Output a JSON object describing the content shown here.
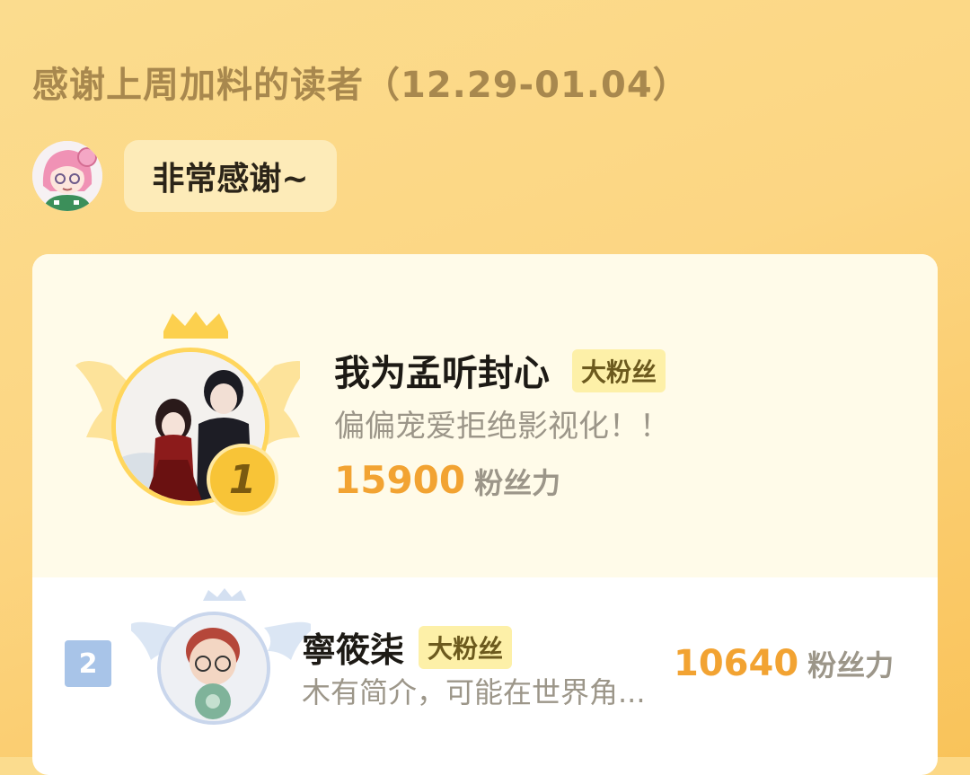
{
  "header": {
    "title": "感谢上周加料的读者（12.29-01.04）"
  },
  "host": {
    "avatar_icon": "girl-avatar",
    "message": "非常感谢~"
  },
  "ranking": [
    {
      "rank": "1",
      "name": "我为孟听封心",
      "badge": "大粉丝",
      "intro": "偏偏宠爱拒绝影视化！！",
      "score": "15900",
      "unit": "粉丝力",
      "avatar_icon": "couple-avatar"
    },
    {
      "rank": "2",
      "name": "寧筱柒",
      "badge": "大粉丝",
      "intro": "木有简介，可能在世界角...",
      "score": "10640",
      "unit": "粉丝力",
      "avatar_icon": "child-avatar"
    }
  ],
  "colors": {
    "score": "#f2a332",
    "gold": "#f8c437",
    "silver": "#a8c4e8"
  }
}
